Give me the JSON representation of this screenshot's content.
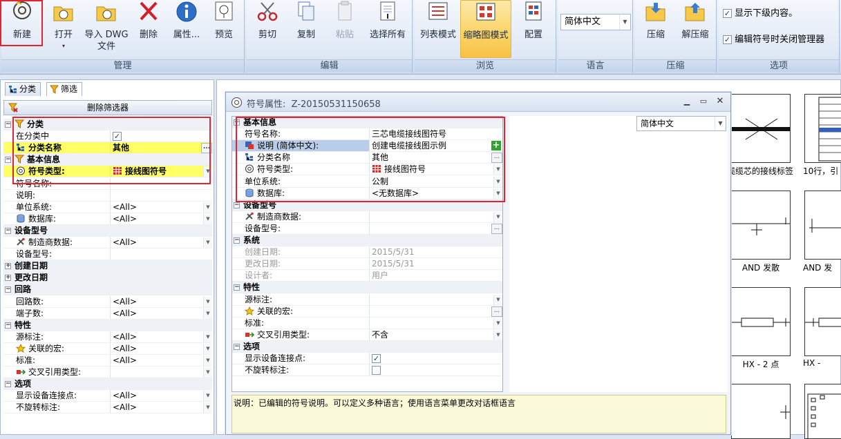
{
  "ribbon": {
    "groups": {
      "manage": "管理",
      "edit": "编辑",
      "browse": "浏览",
      "language": "语言",
      "compress": "压缩",
      "options": "选项"
    },
    "buttons": {
      "new": "新建",
      "open": "打开",
      "import_dwg": "导入 DWG\n文件",
      "delete": "删除",
      "properties": "属性...",
      "preview": "预览",
      "cut": "剪切",
      "copy": "复制",
      "paste": "粘贴",
      "select_all": "选择所有",
      "list_mode": "列表模式",
      "thumbnail_mode": "缩略图模式",
      "configure": "配置",
      "compress": "压缩",
      "decompress": "解压缩"
    },
    "language_combo": "简体中文",
    "options": {
      "show_sub": "显示下级内容。",
      "close_manager": "编辑符号时关闭管理器"
    }
  },
  "left": {
    "tabs": [
      "分类",
      "筛选"
    ],
    "delete_filter": "删除筛选器",
    "rows": [
      {
        "type": "cat",
        "name": "分类",
        "icon": "funnel"
      },
      {
        "name": "在分类中",
        "value": "",
        "check": true
      },
      {
        "name": "分类名称",
        "value": "其他",
        "icon": "tree",
        "hl": true,
        "button": "..."
      },
      {
        "type": "cat",
        "name": "基本信息",
        "icon": "funnel"
      },
      {
        "name": "符号类型:",
        "value": "接线图符号",
        "icon": "symbol",
        "hl": true,
        "dropdown": true,
        "valicon": "grid"
      },
      {
        "name": "符号名称:",
        "value": ""
      },
      {
        "name": "说明:",
        "value": ""
      },
      {
        "name": "单位系统:",
        "value": "<All>",
        "dropdown": true
      },
      {
        "name": "数据库:",
        "value": "<All>",
        "icon": "db",
        "dropdown": true
      },
      {
        "type": "cat",
        "name": "设备型号"
      },
      {
        "name": "制造商数据:",
        "value": "<All>",
        "icon": "tools",
        "dropdown": true
      },
      {
        "name": "设备型号:",
        "value": ""
      },
      {
        "type": "cat",
        "name": "创建日期",
        "collapsed": true
      },
      {
        "type": "cat",
        "name": "更改日期",
        "collapsed": true
      },
      {
        "type": "cat",
        "name": "回路"
      },
      {
        "name": "回路数:",
        "value": "<All>",
        "dropdown": true
      },
      {
        "name": "端子数:",
        "value": "<All>",
        "dropdown": true
      },
      {
        "type": "cat",
        "name": "特性"
      },
      {
        "name": "源标注:",
        "value": "<All>",
        "dropdown": true
      },
      {
        "name": "关联的宏:",
        "value": "<All>",
        "icon": "star",
        "dropdown": true
      },
      {
        "name": "标准:",
        "value": "<All>",
        "dropdown": true
      },
      {
        "name": "交叉引用类型:",
        "value": "",
        "icon": "xref",
        "dropdown": true
      },
      {
        "type": "cat",
        "name": "选项"
      },
      {
        "name": "显示设备连接点:",
        "value": "<All>",
        "dropdown": true
      },
      {
        "name": "不旋转标注:",
        "value": "<All>",
        "dropdown": true
      }
    ]
  },
  "dialog": {
    "title": "符号属性:",
    "symbol_id": "Z-20150531150658",
    "language": "简体中文",
    "rows": [
      {
        "type": "cat",
        "name": "基本信息"
      },
      {
        "name": "符号名称:",
        "value": "三芯电缆接线图符号"
      },
      {
        "name": "说明 (简体中文):",
        "value": "创建电缆接线图示例",
        "icon": "lang",
        "selected": true,
        "plus": true
      },
      {
        "name": "分类名称",
        "value": "其他",
        "icon": "tree",
        "button": "..."
      },
      {
        "name": "符号类型:",
        "value": "接线图符号",
        "icon": "symbol",
        "valicon": "grid",
        "dropdown": true
      },
      {
        "name": "单位系统:",
        "value": "公制",
        "dropdown": true
      },
      {
        "name": "数据库:",
        "value": "<无数据库>",
        "icon": "db",
        "dropdown": true
      },
      {
        "type": "cat",
        "name": "设备型号"
      },
      {
        "name": "制造商数据:",
        "value": "",
        "icon": "tools",
        "dropdown": true
      },
      {
        "name": "设备型号:",
        "value": "",
        "button": "..."
      },
      {
        "type": "cat",
        "name": "系统"
      },
      {
        "name": "创建日期:",
        "value": "2015/5/31",
        "gray": true
      },
      {
        "name": "更改日期:",
        "value": "2015/5/31",
        "gray": true
      },
      {
        "name": "设计者:",
        "value": "用户",
        "gray": true
      },
      {
        "type": "cat",
        "name": "特性"
      },
      {
        "name": "源标注:",
        "value": "",
        "dropdown": true
      },
      {
        "name": "关联的宏:",
        "value": "",
        "icon": "star",
        "button": "..."
      },
      {
        "name": "标准:",
        "value": "",
        "dropdown": true
      },
      {
        "name": "交叉引用类型:",
        "value": "不含",
        "icon": "xref",
        "dropdown": true
      },
      {
        "type": "cat",
        "name": "选项"
      },
      {
        "name": "显示设备连接点:",
        "value": "",
        "check": true
      },
      {
        "name": "不旋转标注:",
        "value": "",
        "check": false
      }
    ],
    "description": "说明：已编辑的符号说明。可以定义多种语言；使用语言菜单更改对话框语言"
  },
  "thumbnails": [
    {
      "label": "缆缆芯的接线标签"
    },
    {
      "label": "10行，引"
    },
    {
      "label": "AND 发散"
    },
    {
      "label": "AND 发"
    },
    {
      "label": "HX - 2 点"
    },
    {
      "label": "HX -"
    }
  ]
}
